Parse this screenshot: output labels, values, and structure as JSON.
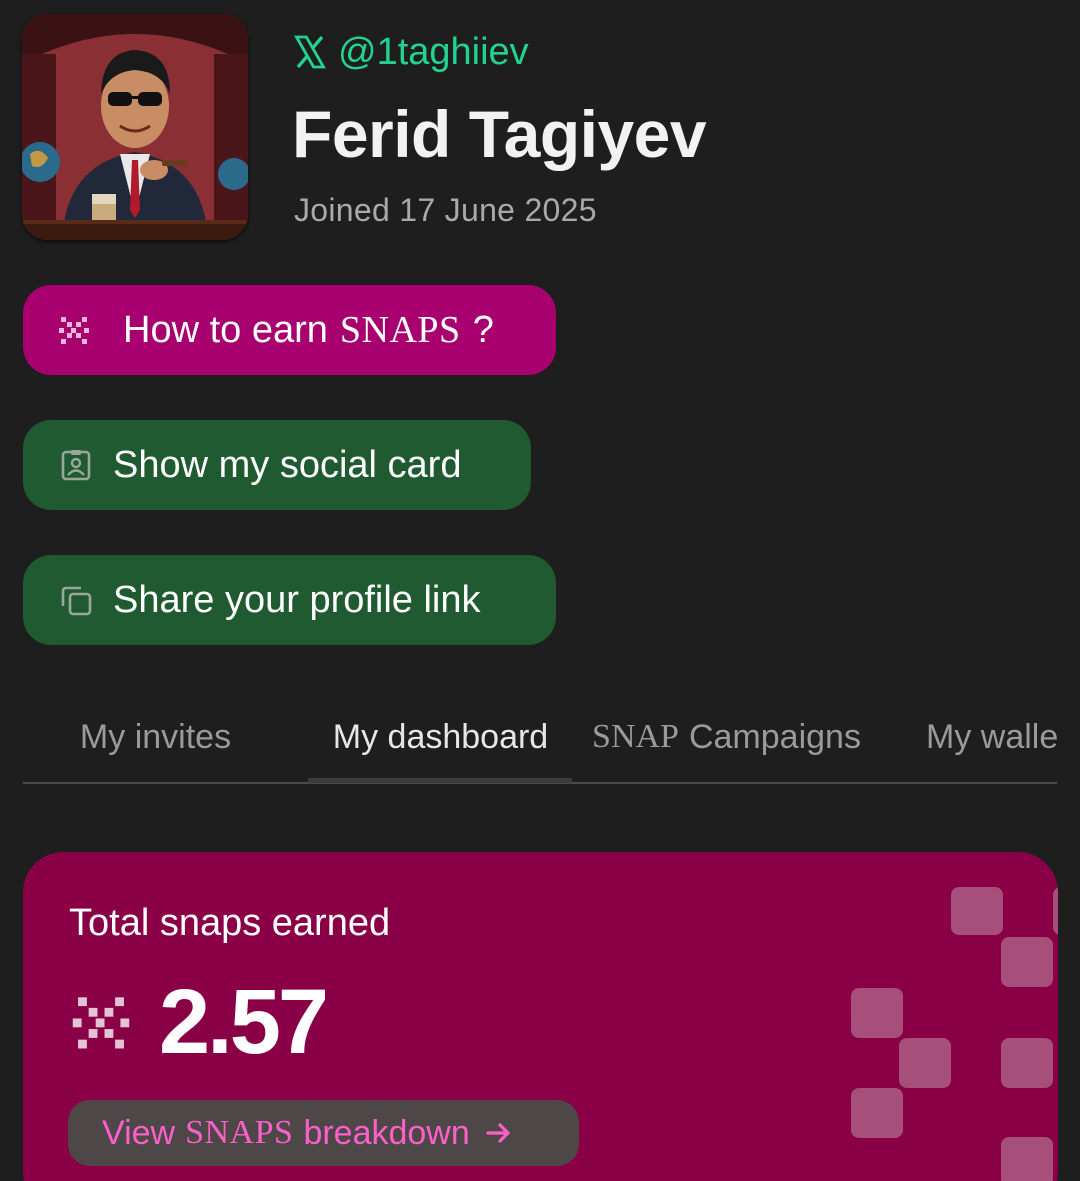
{
  "profile": {
    "handle": "@1taghiiev",
    "name": "Ferid Tagiyev",
    "joined": "Joined 17 June 2025",
    "avatar_icon": "user-avatar-illustration"
  },
  "actions": {
    "earn": {
      "prefix": "How to earn",
      "brand": "SNAPS",
      "suffix": "?",
      "icon": "snaps-logo-icon"
    },
    "social_card": {
      "label": "Show my social card",
      "icon": "id-badge-icon"
    },
    "share": {
      "label": "Share your profile link",
      "icon": "copy-icon"
    }
  },
  "tabs": [
    {
      "label": "My invites"
    },
    {
      "label": "My dashboard",
      "active": true
    },
    {
      "brand": "SNAP",
      "label": "Campaigns"
    },
    {
      "label": "My walle"
    }
  ],
  "summary": {
    "title": "Total snaps earned",
    "value": "2.57",
    "button": {
      "prefix": "View",
      "brand": "SNAPS",
      "suffix": "breakdown",
      "icon": "arrow-right-icon"
    }
  },
  "colors": {
    "background": "#1e1e1e",
    "handle_green": "#22d38f",
    "earn_button": "#a8006e",
    "green_button": "#1f5a30",
    "card": "#8a0046",
    "link_pink": "#ff5fcb"
  }
}
